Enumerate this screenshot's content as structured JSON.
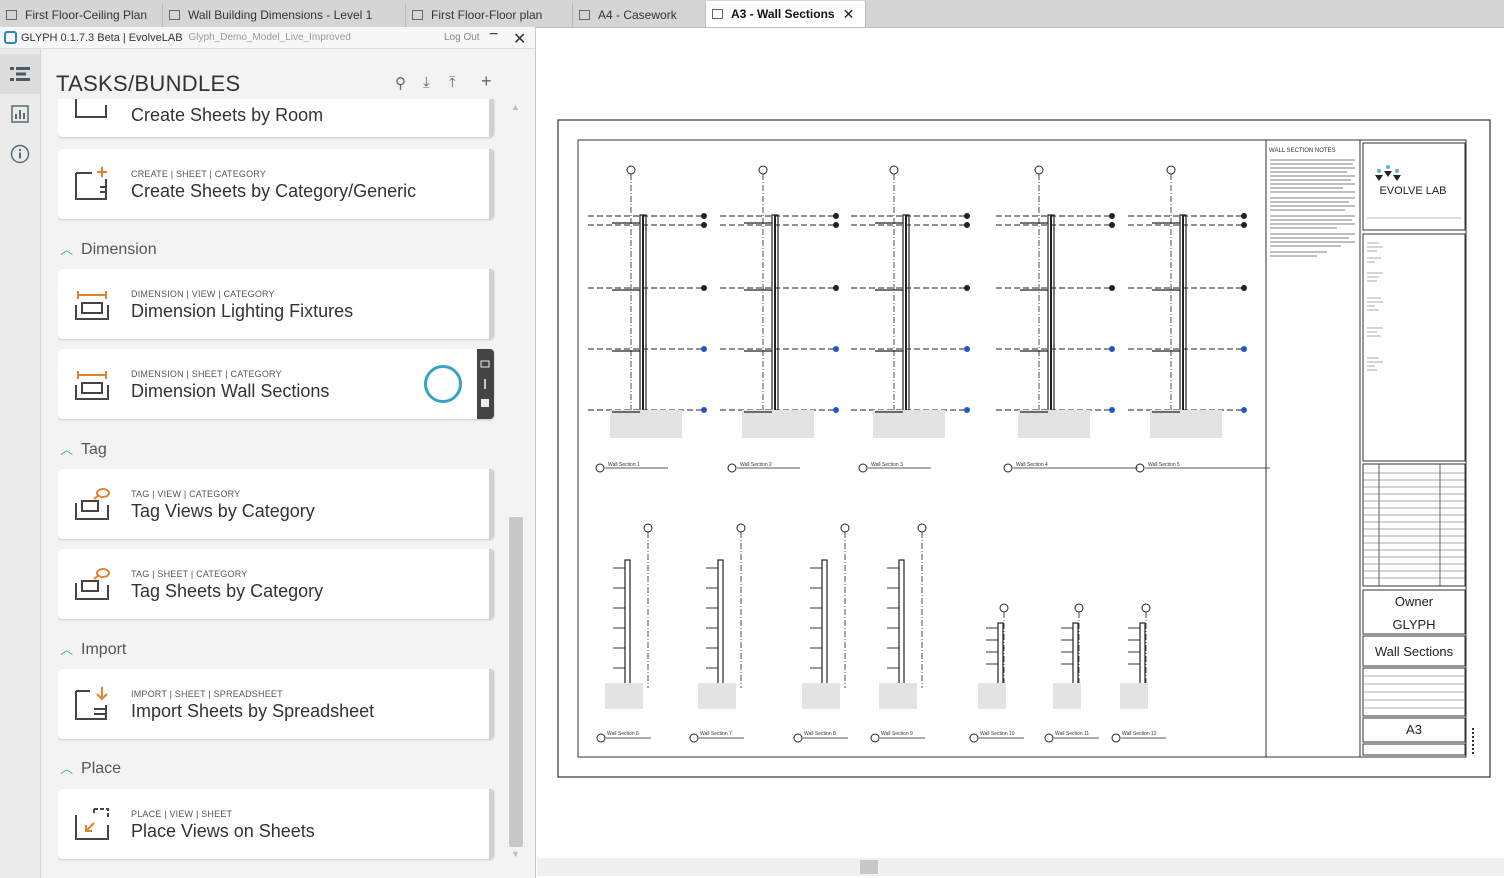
{
  "tabs": [
    {
      "label": "First Floor-Ceiling Plan",
      "active": false
    },
    {
      "label": "Wall Building Dimensions - Level 1",
      "active": false
    },
    {
      "label": "First Floor-Floor plan",
      "active": false
    },
    {
      "label": "A4 - Casework",
      "active": false
    },
    {
      "label": "A3 - Wall Sections",
      "active": true
    }
  ],
  "panel": {
    "app_title": "GLYPH 0.1.7.3 Beta",
    "company": "EvolveLAB",
    "model_name": "Glyph_Demo_Model_Live_Improved",
    "logout": "Log Out",
    "heading": "TASKS/BUNDLES"
  },
  "cards": [
    {
      "crumb": "",
      "title": "Create Sheets by Room"
    },
    {
      "crumb": "CREATE | SHEET | CATEGORY",
      "title": "Create Sheets by Category/Generic"
    },
    {
      "crumb": "DIMENSION | VIEW | CATEGORY",
      "title": "Dimension Lighting Fixtures"
    },
    {
      "crumb": "DIMENSION | SHEET | CATEGORY",
      "title": "Dimension Wall Sections"
    },
    {
      "crumb": "TAG | VIEW | CATEGORY",
      "title": "Tag Views by Category"
    },
    {
      "crumb": "TAG | SHEET | CATEGORY",
      "title": "Tag Sheets by Category"
    },
    {
      "crumb": "IMPORT | SHEET | SPREADSHEET",
      "title": "Import Sheets by Spreadsheet"
    },
    {
      "crumb": "PLACE | VIEW | SHEET",
      "title": "Place Views on Sheets"
    }
  ],
  "groups": [
    "Dimension",
    "Tag",
    "Import",
    "Place"
  ],
  "sheet": {
    "notes_title": "WALL SECTION NOTES",
    "logo_text": "EVOLVE LAB",
    "owner": "Owner",
    "project": "GLYPH",
    "sheet_name": "Wall Sections",
    "sheet_number": "A3",
    "section_labels": [
      "Wall Section 1",
      "Wall Section 2",
      "Wall Section 3",
      "Wall Section 4",
      "Wall Section 5",
      "Wall Section 6",
      "Wall Section 7",
      "Wall Section 8",
      "Wall Section 9",
      "Wall Section 10",
      "Wall Section 11",
      "Wall Section 12"
    ]
  },
  "colors": {
    "accent": "#34a3c4",
    "tab_bar": "#d5d5d5",
    "panel_bg": "#f3f3f3"
  }
}
